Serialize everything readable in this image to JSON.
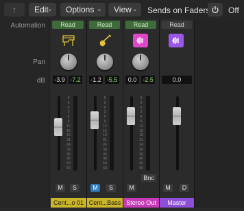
{
  "toolbar": {
    "back_glyph": "↑",
    "edit_label": "Edit",
    "options_label": "Options",
    "view_label": "View",
    "chevron": "⌄",
    "sends_label": "Sends on Faders:",
    "off_label": "Off"
  },
  "row_labels": {
    "automation": "Automation",
    "pan": "Pan",
    "db": "dB"
  },
  "channels": [
    {
      "automation": "Read",
      "icon": "piano-icon",
      "db_volume": "-3.9",
      "db_peak": "-7.2",
      "buttons": [
        "M",
        "S"
      ],
      "name": "Cent...o 01",
      "name_color": "#c9b42a"
    },
    {
      "automation": "Read",
      "icon": "guitar-icon",
      "db_volume": "-1.2",
      "db_peak": "-5.5",
      "buttons": [
        "M",
        "S"
      ],
      "name": "Cent...Bass",
      "name_color": "#c9b42a"
    },
    {
      "automation": "Read",
      "icon": "stereo-out-icon",
      "db_volume": "0.0",
      "db_peak": "-2.5",
      "buttons": [
        "M"
      ],
      "name": "Stereo Out",
      "name_color": "#c93ab8",
      "extra_button": "Bnc"
    },
    {
      "automation": "Read",
      "icon": "master-icon",
      "db_volume": "0.0",
      "db_peak": "",
      "buttons": [
        "M",
        "D"
      ],
      "name": "Master",
      "name_color": "#8e4fd8"
    }
  ],
  "scale_labels": [
    "6",
    "3",
    "0",
    "3",
    "6",
    "9",
    "12",
    "15",
    "18",
    "21",
    "24",
    "30",
    "35",
    "40",
    "50",
    "60"
  ],
  "colors": {
    "accent_green": "#3f6b3a",
    "solo_blue": "#2f7bbf",
    "stereo_pink": "#e046c9",
    "master_purple": "#9a57e6",
    "instrument_yellow": "#c9b42a"
  }
}
